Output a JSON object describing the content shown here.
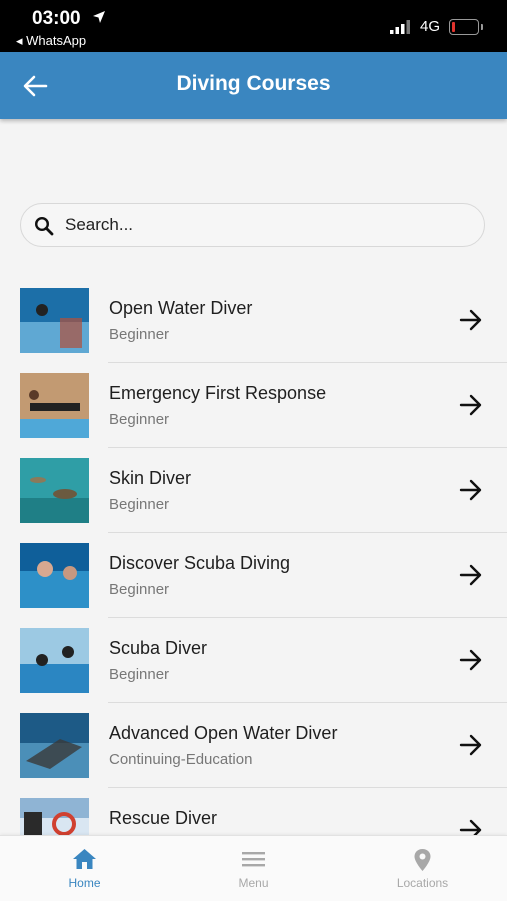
{
  "status_bar": {
    "time": "03:00",
    "back_app": "◂ WhatsApp",
    "network": "4G"
  },
  "header": {
    "title": "Diving Courses"
  },
  "search": {
    "placeholder": "Search..."
  },
  "courses": [
    {
      "name": "Open Water Diver",
      "level": "Beginner",
      "thumb_colors": [
        "#1c6fa8",
        "#5fa8d3"
      ]
    },
    {
      "name": "Emergency First Response",
      "level": "Beginner",
      "thumb_colors": [
        "#c29a72",
        "#4fa8d8"
      ]
    },
    {
      "name": "Skin Diver",
      "level": "Beginner",
      "thumb_colors": [
        "#2f9ea6",
        "#1f7f86"
      ]
    },
    {
      "name": "Discover Scuba Diving",
      "level": "Beginner",
      "thumb_colors": [
        "#0f5f9a",
        "#2d90c8"
      ]
    },
    {
      "name": "Scuba Diver",
      "level": "Beginner",
      "thumb_colors": [
        "#9cc9e3",
        "#2b86c2"
      ]
    },
    {
      "name": "Advanced Open Water Diver",
      "level": "Continuing-Education",
      "thumb_colors": [
        "#1d5a86",
        "#4b8fb8"
      ]
    },
    {
      "name": "Rescue Diver",
      "level": "",
      "thumb_colors": [
        "#8fb4d4",
        "#d9e6f2"
      ]
    }
  ],
  "tabs": [
    {
      "label": "Home",
      "icon": "home-icon",
      "active": true
    },
    {
      "label": "Menu",
      "icon": "menu-icon",
      "active": false
    },
    {
      "label": "Locations",
      "icon": "location-pin-icon",
      "active": false
    }
  ],
  "colors": {
    "accent": "#3a86c0",
    "tab_inactive": "#a8a8a8"
  }
}
